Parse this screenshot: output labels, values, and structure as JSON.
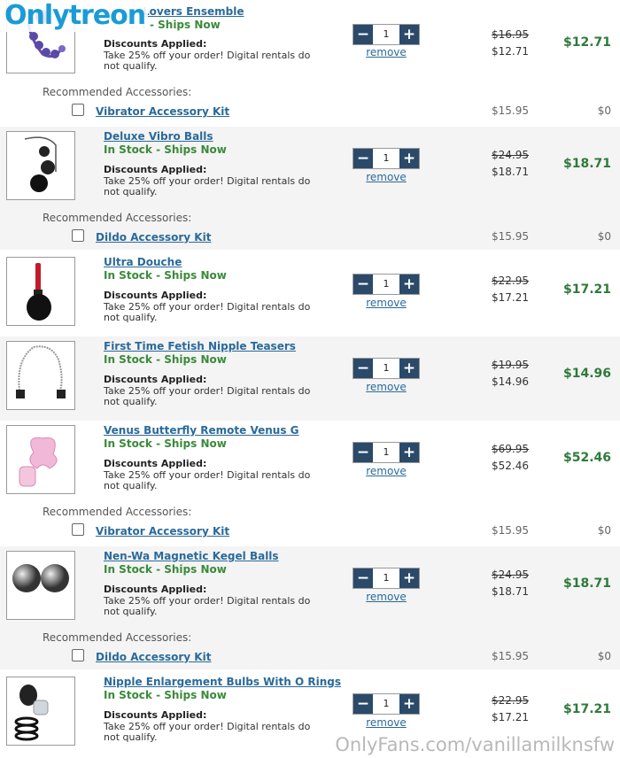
{
  "watermark": {
    "logo": "Onlytreon",
    "footer": "OnlyFans.com/vanillamilknsfw"
  },
  "common": {
    "stock": "In Stock - Ships Now",
    "discount_heading": "Discounts Applied:",
    "discount_text": "Take 25% off your order! Digital rentals do not qualify.",
    "remove": "remove",
    "qty": "1",
    "minus": "−",
    "plus": "+",
    "rec_heading": "Recommended Accessories:"
  },
  "items": [
    {
      "name": "Lovers Ensemble",
      "stock_partial": ": - Ships Now",
      "was": "$16.95",
      "now": "$12.71",
      "total": "$12.71",
      "image_icon": "purple-beads"
    },
    {
      "name": "Deluxe Vibro Balls",
      "was": "$24.95",
      "now": "$18.71",
      "total": "$18.71",
      "image_icon": "black-balls"
    },
    {
      "name": "Ultra Douche",
      "was": "$22.95",
      "now": "$17.21",
      "total": "$17.21",
      "image_icon": "douche-bulb"
    },
    {
      "name": "First Time Fetish Nipple Teasers",
      "was": "$19.95",
      "now": "$14.96",
      "total": "$14.96",
      "image_icon": "chain-clamps"
    },
    {
      "name": "Venus Butterfly Remote Venus G",
      "was": "$69.95",
      "now": "$52.46",
      "total": "$52.46",
      "image_icon": "pink-butterfly"
    },
    {
      "name": "Nen-Wa Magnetic Kegel Balls",
      "was": "$24.95",
      "now": "$18.71",
      "total": "$18.71",
      "image_icon": "metal-balls"
    },
    {
      "name": "Nipple Enlargement Bulbs With O Rings",
      "was": "$22.95",
      "now": "$17.21",
      "total": "$17.21",
      "image_icon": "bulbs-rings"
    }
  ],
  "accessories": [
    {
      "name": "Vibrator Accessory Kit",
      "price": "$15.95",
      "added": "$0"
    },
    {
      "name": "Dildo Accessory Kit",
      "price": "$15.95",
      "added": "$0"
    },
    {
      "name": "Vibrator Accessory Kit",
      "price": "$15.95",
      "added": "$0"
    },
    {
      "name": "Dildo Accessory Kit",
      "price": "$15.95",
      "added": "$0"
    }
  ]
}
